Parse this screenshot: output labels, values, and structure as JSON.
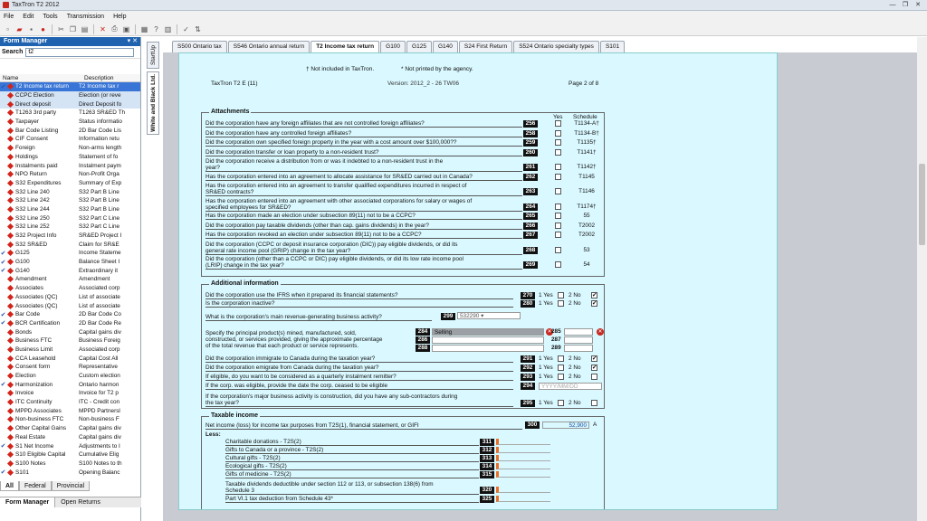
{
  "window": {
    "title": "TaxTron T2 2012",
    "min": "—",
    "max": "❐",
    "close": "✕"
  },
  "menu": [
    "File",
    "Edit",
    "Tools",
    "Transmission",
    "Help"
  ],
  "form_manager": {
    "title": "Form Manager",
    "pin": "▾ ✕",
    "search_label": "Search",
    "search_value": "t2",
    "col_name": "Name",
    "col_desc": "Description",
    "rows": [
      {
        "c": "✔",
        "n": "T2 Income tax return",
        "d": "T2 Income tax r",
        "s": "sel"
      },
      {
        "c": "",
        "n": "CCPC Election",
        "d": "Election (or reve",
        "s": "hl"
      },
      {
        "c": "",
        "n": "Direct deposit",
        "d": "Direct Deposit fo",
        "s": "hl"
      },
      {
        "c": "",
        "n": "T1263 3rd party",
        "d": "T1263 SR&ED Th",
        "s": ""
      },
      {
        "c": "",
        "n": "Taxpayer",
        "d": "Status informatio",
        "s": ""
      },
      {
        "c": "",
        "n": "Bar Code Listing",
        "d": "2D Bar Code Lis",
        "s": ""
      },
      {
        "c": "",
        "n": "CIF Consent",
        "d": "Information retu",
        "s": ""
      },
      {
        "c": "",
        "n": "Foreign",
        "d": "Non-arms length",
        "s": ""
      },
      {
        "c": "",
        "n": "Holdings",
        "d": "Statement of fo",
        "s": ""
      },
      {
        "c": "",
        "n": "Instalments paid",
        "d": "Instalment paym",
        "s": ""
      },
      {
        "c": "",
        "n": "NPO Return",
        "d": "Non-Profit Orga",
        "s": ""
      },
      {
        "c": "",
        "n": "S32 Expenditures",
        "d": "Summary of Exp",
        "s": ""
      },
      {
        "c": "",
        "n": "S32 Line 240",
        "d": "S32 Part B Line",
        "s": ""
      },
      {
        "c": "",
        "n": "S32 Line 242",
        "d": "S32 Part B Line",
        "s": ""
      },
      {
        "c": "",
        "n": "S32 Line 244",
        "d": "S32 Part B Line",
        "s": ""
      },
      {
        "c": "",
        "n": "S32 Line 250",
        "d": "S32 Part C Line",
        "s": ""
      },
      {
        "c": "",
        "n": "S32 Line 252",
        "d": "S32 Part C Line",
        "s": ""
      },
      {
        "c": "",
        "n": "S32 Project Info",
        "d": "SR&ED Project I",
        "s": ""
      },
      {
        "c": "",
        "n": "S32 SR&ED",
        "d": "Claim for SR&E",
        "s": ""
      },
      {
        "c": "✔",
        "n": "G125",
        "d": "Income Stateme",
        "s": ""
      },
      {
        "c": "✔",
        "n": "G100",
        "d": "Balance Sheet I",
        "s": ""
      },
      {
        "c": "✔",
        "n": "G140",
        "d": "Extraordinary it",
        "s": ""
      },
      {
        "c": "",
        "n": "Amendment",
        "d": "Amendment",
        "s": ""
      },
      {
        "c": "",
        "n": "Associates",
        "d": "Associated corp",
        "s": ""
      },
      {
        "c": "",
        "n": "Associates (QC)",
        "d": "List of associate",
        "s": ""
      },
      {
        "c": "",
        "n": "Associates (QC)",
        "d": "List of associate",
        "s": ""
      },
      {
        "c": "✔",
        "n": "Bar Code",
        "d": "2D Bar Code Co",
        "s": ""
      },
      {
        "c": "✔",
        "n": "BCR Certification",
        "d": "2D Bar Code Re",
        "s": ""
      },
      {
        "c": "",
        "n": "Bonds",
        "d": "Capital gains div",
        "s": ""
      },
      {
        "c": "",
        "n": "Business FTC",
        "d": "Business Foreig",
        "s": ""
      },
      {
        "c": "",
        "n": "Business Limit",
        "d": "Associated corp",
        "s": ""
      },
      {
        "c": "",
        "n": "CCA Leasehold",
        "d": "Capital Cost All",
        "s": ""
      },
      {
        "c": "",
        "n": "Consent form",
        "d": "Representative",
        "s": ""
      },
      {
        "c": "",
        "n": "Election",
        "d": "Custom election",
        "s": ""
      },
      {
        "c": "✔",
        "n": "Harmonization",
        "d": "Ontario harmon",
        "s": ""
      },
      {
        "c": "",
        "n": "Invoice",
        "d": "Invoice for T2 p",
        "s": ""
      },
      {
        "c": "",
        "n": "ITC Continuity",
        "d": "ITC - Credit con",
        "s": ""
      },
      {
        "c": "",
        "n": "MPPD Associates",
        "d": "MPPD Partnersl",
        "s": ""
      },
      {
        "c": "",
        "n": "Non-business FTC",
        "d": "Non-business F",
        "s": ""
      },
      {
        "c": "",
        "n": "Other Capital Gains",
        "d": "Capital gains div",
        "s": ""
      },
      {
        "c": "",
        "n": "Real Estate",
        "d": "Capital gains div",
        "s": ""
      },
      {
        "c": "✔",
        "n": "S1 Net Income",
        "d": "Adjustments to I",
        "s": ""
      },
      {
        "c": "",
        "n": "S10 Eligible Capital",
        "d": "Cumulative Elig",
        "s": ""
      },
      {
        "c": "",
        "n": "S100 Notes",
        "d": "S100 Notes to th",
        "s": ""
      },
      {
        "c": "✔",
        "n": "S101",
        "d": "Opening Balanc",
        "s": ""
      }
    ],
    "tabs": [
      "All",
      "Federal",
      "Provincial"
    ],
    "bottom_tabs": [
      "Form Manager",
      "Open Returns"
    ]
  },
  "side_tabs": [
    "StartUp",
    "White and Black Ltd."
  ],
  "doc_tabs": [
    {
      "label": "S500 Ontario tax",
      "w": 58
    },
    {
      "label": "S546 Ontario annual return",
      "w": 92
    },
    {
      "label": "T2 Income tax return",
      "w": 74,
      "active": true
    },
    {
      "label": "G100",
      "w": 26
    },
    {
      "label": "G125",
      "w": 26
    },
    {
      "label": "G140",
      "w": 26
    },
    {
      "label": "S24 First Return",
      "w": 58
    },
    {
      "label": "S524 Ontario specialty types",
      "w": 98
    },
    {
      "label": "S101",
      "w": 24
    }
  ],
  "form": {
    "note_not_included": "† Not included in TaxTron.",
    "note_not_printed": "* Not printed by the agency.",
    "form_id": "TaxTron T2 E (11)",
    "version": "Version: 2012_2 - 26 TW06",
    "page": "Page 2 of 8",
    "attachments": {
      "title": "Attachments",
      "yes": "Yes",
      "schedule": "Schedule",
      "rows": [
        {
          "q": "Did the corporation have any foreign affiliates that are not controlled foreign affiliates?",
          "l": "256",
          "s": "T1134-A†",
          "h": 1
        },
        {
          "q": "Did the corporation have any controlled foreign affiliates?",
          "l": "258",
          "s": "T1134-B†",
          "h": 1
        },
        {
          "q": "Did the corporation own specified foreign property in the year with a cost amount over $100,000??",
          "l": "259",
          "s": "T1135†",
          "h": 1
        },
        {
          "q": "Did the corporation transfer or loan property to a non-resident trust?",
          "l": "260",
          "s": "T1141†",
          "h": 1
        },
        {
          "q": "Did the corporation receive a distribution from or was it indebted to a non-resident trust in the|year?",
          "l": "261",
          "s": "T1142†",
          "h": 2
        },
        {
          "q": "Has the corporation entered into an agreement to allocate assistance for SR&ED carried out in Canada?",
          "l": "262",
          "s": "T1145",
          "h": 1
        },
        {
          "q": "Has the corporation entered into an agreement to transfer qualified expenditures incurred in respect of|SR&ED contracts?",
          "l": "263",
          "s": "T1146",
          "h": 2
        },
        {
          "q": "Has the corporation entered into an agreement with other associated corporations for salary or wages of|specified employees for SR&ED?",
          "l": "264",
          "s": "T1174†",
          "h": 2
        },
        {
          "q": "Has the corporation made an election under subsection 89(11) not to be a CCPC?",
          "l": "265",
          "s": "55",
          "h": 1
        },
        {
          "q": "Did the corporation pay taxable dividends (other than cap. gains dividends) in the year?",
          "l": "266",
          "s": "T2002",
          "h": 1
        },
        {
          "q": "Has the corporation revoked an election under subsection 89(11) not to be a CCPC?",
          "l": "267",
          "s": "T2002",
          "h": 1
        },
        {
          "q": "Did the corporation (CCPC or deposit insurance corporation (DIC)) pay eligible dividends, or did its|general rate income pool (GRIP) change in the tax year?",
          "l": "268",
          "s": "53",
          "h": 2
        },
        {
          "q": "Did the corporation (other than a CCPC or DIC) pay eligible dividends, or did its low rate income pool|(LRIP) change in the tax year?",
          "l": "269",
          "s": "54",
          "h": 2
        }
      ]
    },
    "additional": {
      "title": "Additional information",
      "q270": "Did the corporation use the IFRS when it prepared its financial statements?",
      "l270": "270",
      "q280": "Is the corporation inactive?",
      "l280": "280",
      "q299": "What is the corporation's main revenue-generating business activity?",
      "l299": "299",
      "v299": "532290",
      "q284a": "Specify the principal product(s) mined, manufactured, sold,",
      "q284b": "constructed, or services provided, giving the approximate percentage",
      "q284c": "of the total revenue that each product or service represents.",
      "l284": "284",
      "l286": "286",
      "l288": "288",
      "l285": "285",
      "l287": "287",
      "l289": "289",
      "v284": "Selling",
      "q291": "Did the corporation immigrate to Canada during the taxation year?",
      "l291": "291",
      "q292": "Did the corporation emigrate from Canada during the taxation year?",
      "l292": "292",
      "q293": "If eligible, do you want to be considered as a quarterly instalment remitter?",
      "l293": "293",
      "q294": "If the corp. was eligible, provide the date the corp. ceased to be eligible",
      "l294": "294",
      "ph294": "YYYY/MM/DD",
      "q295a": "If the corporation's major business activity is construction, did you have any sub-contractors during",
      "q295b": "the tax year?",
      "l295": "295",
      "yes1": "1 Yes",
      "no2": "2 No"
    },
    "taxable": {
      "title": "Taxable income",
      "q300": "Net income (loss) for income tax purposes from T2S(1), financial statement, or GIFI",
      "l300": "300",
      "v300": "52,900",
      "a": "A",
      "less": "Less:",
      "rows": [
        {
          "q": "Charitable donations - T2S(2)",
          "l": "311"
        },
        {
          "q": "Gifts to Canada or a province - T2S(2)",
          "l": "312"
        },
        {
          "q": "Cultural gifts - T2S(2)",
          "l": "313"
        },
        {
          "q": "Ecological gifts - T2S(2)",
          "l": "314"
        },
        {
          "q": "Gifts of medicine - T2S(2)",
          "l": "315"
        }
      ],
      "q320a": "Taxable dividends deductible under section 112 or 113, or subsection 138(6) from",
      "q320b": "Schedule 3",
      "l320": "320",
      "q325": "Part VI.1 tax deduction from Schedule 43*",
      "l325": "325"
    }
  }
}
